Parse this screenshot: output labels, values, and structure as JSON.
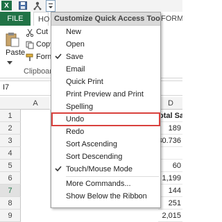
{
  "titlebar": {
    "logo_text": "X",
    "qat_icons": [
      "excel-logo",
      "save-icon",
      "touch-mode-icon",
      "qat-customize-dropdown-icon"
    ]
  },
  "ribbon": {
    "tabs": {
      "file": "FILE",
      "home": "HO",
      "formulas": "FORMU"
    },
    "clipboard": {
      "paste": "Paste",
      "cut": "Cut",
      "copy": "Copy",
      "format": "Form",
      "group_label": "Clipboar"
    }
  },
  "namebox": {
    "value": "I7"
  },
  "grid": {
    "columns": [
      "A",
      "D"
    ],
    "rows": [
      "1",
      "2",
      "3",
      "4",
      "5",
      "6",
      "7",
      "8",
      "9"
    ],
    "selected_row": "7",
    "col_d": [
      "otal Sal",
      "189",
      "80.736",
      "",
      "60",
      "1,199",
      "144",
      "251",
      "2,015"
    ]
  },
  "menu": {
    "header": "Customize Quick Access Toolbar",
    "items": [
      {
        "label": "New",
        "checked": false
      },
      {
        "label": "Open",
        "checked": false
      },
      {
        "label": "Save",
        "checked": true
      },
      {
        "label": "Email",
        "checked": false
      },
      {
        "label": "Quick Print",
        "checked": false
      },
      {
        "label": "Print Preview and Print",
        "checked": false
      },
      {
        "label": "Spelling",
        "checked": false
      },
      {
        "label": "Undo",
        "checked": false
      },
      {
        "label": "Redo",
        "checked": false
      },
      {
        "label": "Sort Ascending",
        "checked": false
      },
      {
        "label": "Sort Descending",
        "checked": false
      },
      {
        "label": "Touch/Mouse Mode",
        "checked": true
      },
      {
        "label": "More Commands...",
        "checked": false
      },
      {
        "label": "Show Below the Ribbon",
        "checked": false
      }
    ],
    "highlighted": "Undo",
    "colors": {
      "highlight_border": "#d9413d",
      "file_tab": "#217346"
    }
  }
}
